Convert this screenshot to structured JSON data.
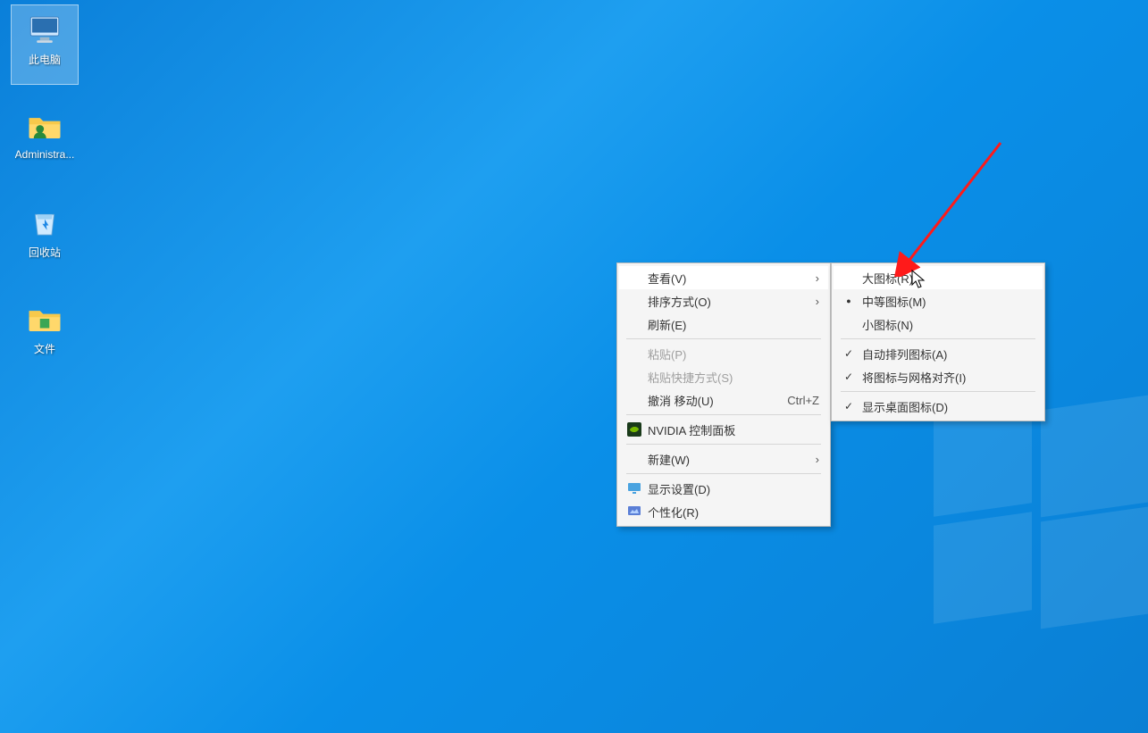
{
  "desktop": {
    "icons": [
      {
        "id": "this-pc",
        "label": "此电脑",
        "selected": true
      },
      {
        "id": "user-home",
        "label": "Administra...",
        "selected": false
      },
      {
        "id": "recycle",
        "label": "回收站",
        "selected": false
      },
      {
        "id": "folder",
        "label": "文件",
        "selected": false
      }
    ]
  },
  "context_menu": {
    "main": [
      {
        "id": "view",
        "label": "查看(V)",
        "submenu": true,
        "hover": true
      },
      {
        "id": "sort",
        "label": "排序方式(O)",
        "submenu": true
      },
      {
        "id": "refresh",
        "label": "刷新(E)"
      },
      {
        "sep": true
      },
      {
        "id": "paste",
        "label": "粘贴(P)",
        "disabled": true
      },
      {
        "id": "paste-short",
        "label": "粘贴快捷方式(S)",
        "disabled": true
      },
      {
        "id": "undo",
        "label": "撤消 移动(U)",
        "shortcut": "Ctrl+Z"
      },
      {
        "sep": true
      },
      {
        "id": "nvidia",
        "label": "NVIDIA 控制面板",
        "icon": "nvidia"
      },
      {
        "sep": true
      },
      {
        "id": "new",
        "label": "新建(W)",
        "submenu": true
      },
      {
        "sep": true
      },
      {
        "id": "display",
        "label": "显示设置(D)",
        "icon": "display"
      },
      {
        "id": "personalize",
        "label": "个性化(R)",
        "icon": "personalize"
      }
    ],
    "sub_view": [
      {
        "id": "large",
        "label": "大图标(R)",
        "hover": true
      },
      {
        "id": "medium",
        "label": "中等图标(M)",
        "mark": "dot"
      },
      {
        "id": "small",
        "label": "小图标(N)"
      },
      {
        "sep": true
      },
      {
        "id": "autoarr",
        "label": "自动排列图标(A)",
        "mark": "check"
      },
      {
        "id": "align",
        "label": "将图标与网格对齐(I)",
        "mark": "check"
      },
      {
        "sep": true
      },
      {
        "id": "showd",
        "label": "显示桌面图标(D)",
        "mark": "check"
      }
    ]
  }
}
